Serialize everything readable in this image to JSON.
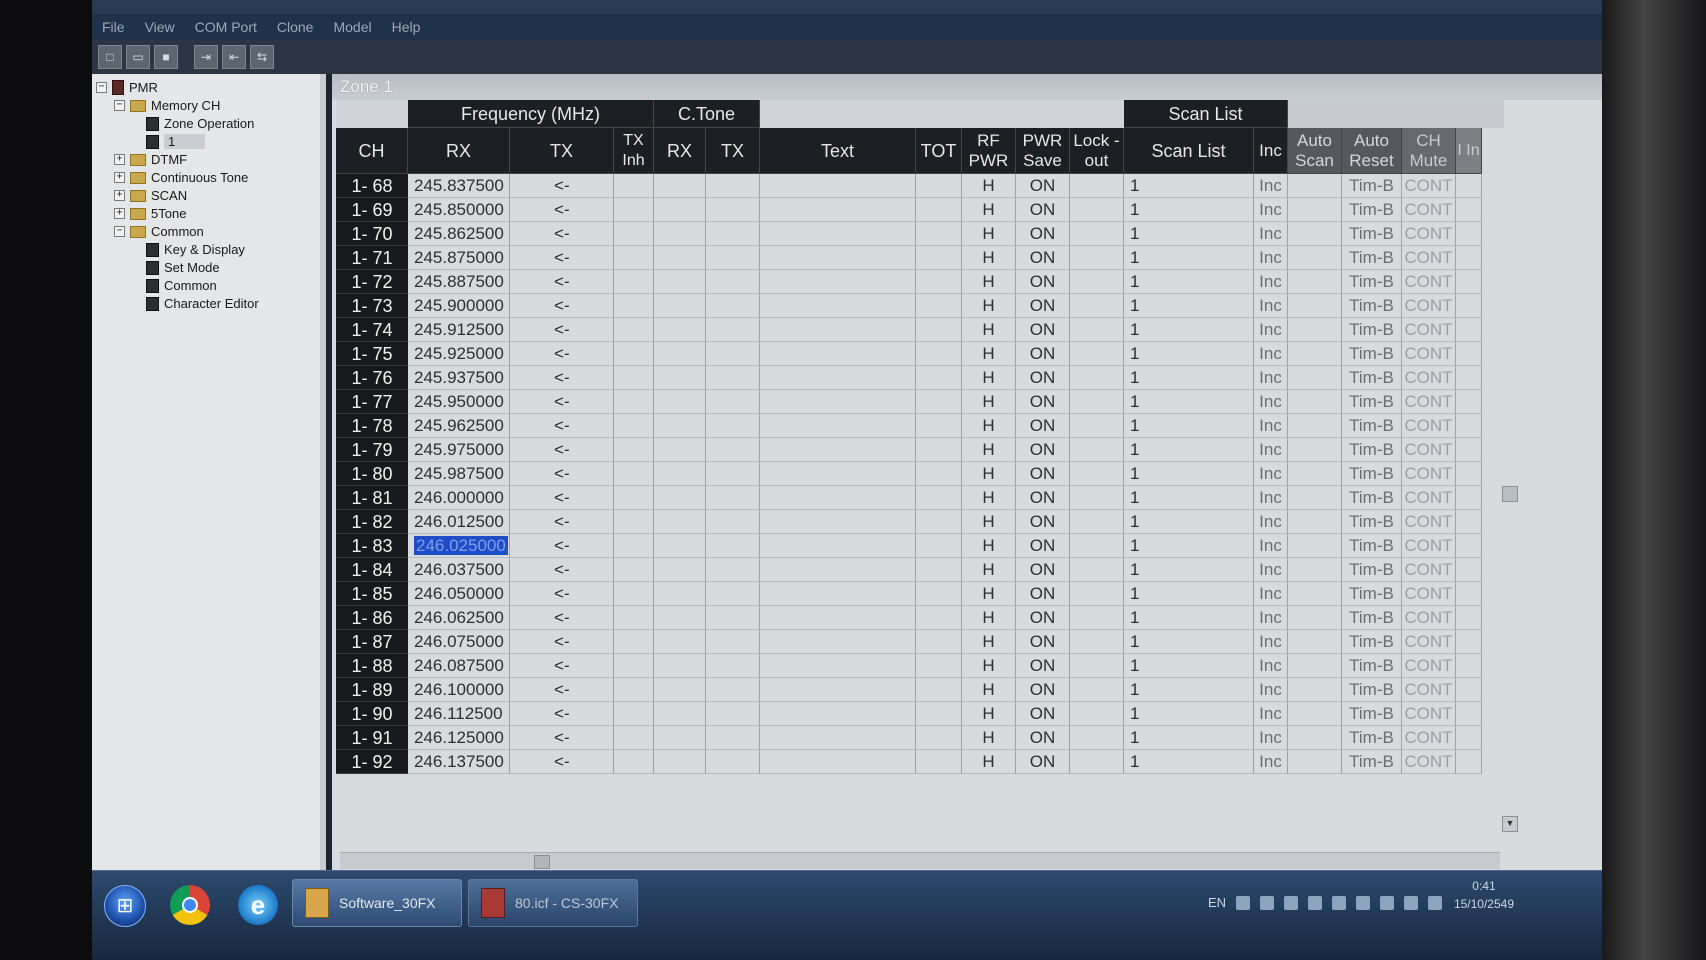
{
  "menu": [
    "File",
    "View",
    "COM Port",
    "Clone",
    "Model",
    "Help"
  ],
  "toolbar_icons": [
    "new-icon",
    "open-icon",
    "save-icon",
    "read-icon",
    "write-icon",
    "clone-icon"
  ],
  "tree": {
    "root": "PMR",
    "memory_ch": "Memory CH",
    "zone_operation": "Zone Operation",
    "zone_1": "1",
    "dtmf": "DTMF",
    "continuous_tone": "Continuous Tone",
    "scan": "SCAN",
    "five_tone": "5Tone",
    "common": "Common",
    "key_display": "Key & Display",
    "set_mode": "Set Mode",
    "common_sub": "Common",
    "character_editor": "Character Editor"
  },
  "zone_title": "Zone 1",
  "headers": {
    "frequency_group": "Frequency (MHz)",
    "ctone_group": "C.Tone",
    "scanlist_group": "Scan List",
    "ch": "CH",
    "rx": "RX",
    "tx": "TX",
    "tx_inh": "TX Inh",
    "ctone_rx": "RX",
    "ctone_tx": "TX",
    "text": "Text",
    "tot": "TOT",
    "rf_pwr": "RF PWR",
    "pwr_save": "PWR Save",
    "lockout": "Lock -out",
    "scan_list": "Scan List",
    "inc": "Inc",
    "auto_scan": "Auto Scan",
    "auto_reset": "Auto Reset",
    "ch_mute": "CH Mute",
    "last_col": "I In"
  },
  "rows": [
    {
      "ch": "1- 68",
      "rx": "245.837500",
      "tx": "<-",
      "rf_pwr": "H",
      "pwr_save": "ON",
      "scan_list": "1",
      "inc": "Inc",
      "auto_reset": "Tim-B",
      "ch_mute": "CONT"
    },
    {
      "ch": "1- 69",
      "rx": "245.850000",
      "tx": "<-",
      "rf_pwr": "H",
      "pwr_save": "ON",
      "scan_list": "1",
      "inc": "Inc",
      "auto_reset": "Tim-B",
      "ch_mute": "CONT"
    },
    {
      "ch": "1- 70",
      "rx": "245.862500",
      "tx": "<-",
      "rf_pwr": "H",
      "pwr_save": "ON",
      "scan_list": "1",
      "inc": "Inc",
      "auto_reset": "Tim-B",
      "ch_mute": "CONT"
    },
    {
      "ch": "1- 71",
      "rx": "245.875000",
      "tx": "<-",
      "rf_pwr": "H",
      "pwr_save": "ON",
      "scan_list": "1",
      "inc": "Inc",
      "auto_reset": "Tim-B",
      "ch_mute": "CONT"
    },
    {
      "ch": "1- 72",
      "rx": "245.887500",
      "tx": "<-",
      "rf_pwr": "H",
      "pwr_save": "ON",
      "scan_list": "1",
      "inc": "Inc",
      "auto_reset": "Tim-B",
      "ch_mute": "CONT"
    },
    {
      "ch": "1- 73",
      "rx": "245.900000",
      "tx": "<-",
      "rf_pwr": "H",
      "pwr_save": "ON",
      "scan_list": "1",
      "inc": "Inc",
      "auto_reset": "Tim-B",
      "ch_mute": "CONT"
    },
    {
      "ch": "1- 74",
      "rx": "245.912500",
      "tx": "<-",
      "rf_pwr": "H",
      "pwr_save": "ON",
      "scan_list": "1",
      "inc": "Inc",
      "auto_reset": "Tim-B",
      "ch_mute": "CONT"
    },
    {
      "ch": "1- 75",
      "rx": "245.925000",
      "tx": "<-",
      "rf_pwr": "H",
      "pwr_save": "ON",
      "scan_list": "1",
      "inc": "Inc",
      "auto_reset": "Tim-B",
      "ch_mute": "CONT"
    },
    {
      "ch": "1- 76",
      "rx": "245.937500",
      "tx": "<-",
      "rf_pwr": "H",
      "pwr_save": "ON",
      "scan_list": "1",
      "inc": "Inc",
      "auto_reset": "Tim-B",
      "ch_mute": "CONT"
    },
    {
      "ch": "1- 77",
      "rx": "245.950000",
      "tx": "<-",
      "rf_pwr": "H",
      "pwr_save": "ON",
      "scan_list": "1",
      "inc": "Inc",
      "auto_reset": "Tim-B",
      "ch_mute": "CONT"
    },
    {
      "ch": "1- 78",
      "rx": "245.962500",
      "tx": "<-",
      "rf_pwr": "H",
      "pwr_save": "ON",
      "scan_list": "1",
      "inc": "Inc",
      "auto_reset": "Tim-B",
      "ch_mute": "CONT"
    },
    {
      "ch": "1- 79",
      "rx": "245.975000",
      "tx": "<-",
      "rf_pwr": "H",
      "pwr_save": "ON",
      "scan_list": "1",
      "inc": "Inc",
      "auto_reset": "Tim-B",
      "ch_mute": "CONT"
    },
    {
      "ch": "1- 80",
      "rx": "245.987500",
      "tx": "<-",
      "rf_pwr": "H",
      "pwr_save": "ON",
      "scan_list": "1",
      "inc": "Inc",
      "auto_reset": "Tim-B",
      "ch_mute": "CONT"
    },
    {
      "ch": "1- 81",
      "rx": "246.000000",
      "tx": "<-",
      "rf_pwr": "H",
      "pwr_save": "ON",
      "scan_list": "1",
      "inc": "Inc",
      "auto_reset": "Tim-B",
      "ch_mute": "CONT"
    },
    {
      "ch": "1- 82",
      "rx": "246.012500",
      "tx": "<-",
      "rf_pwr": "H",
      "pwr_save": "ON",
      "scan_list": "1",
      "inc": "Inc",
      "auto_reset": "Tim-B",
      "ch_mute": "CONT"
    },
    {
      "ch": "1- 83",
      "rx": "246.025000",
      "tx": "<-",
      "rf_pwr": "H",
      "pwr_save": "ON",
      "scan_list": "1",
      "inc": "Inc",
      "auto_reset": "Tim-B",
      "ch_mute": "CONT",
      "selected": true
    },
    {
      "ch": "1- 84",
      "rx": "246.037500",
      "tx": "<-",
      "rf_pwr": "H",
      "pwr_save": "ON",
      "scan_list": "1",
      "inc": "Inc",
      "auto_reset": "Tim-B",
      "ch_mute": "CONT"
    },
    {
      "ch": "1- 85",
      "rx": "246.050000",
      "tx": "<-",
      "rf_pwr": "H",
      "pwr_save": "ON",
      "scan_list": "1",
      "inc": "Inc",
      "auto_reset": "Tim-B",
      "ch_mute": "CONT"
    },
    {
      "ch": "1- 86",
      "rx": "246.062500",
      "tx": "<-",
      "rf_pwr": "H",
      "pwr_save": "ON",
      "scan_list": "1",
      "inc": "Inc",
      "auto_reset": "Tim-B",
      "ch_mute": "CONT"
    },
    {
      "ch": "1- 87",
      "rx": "246.075000",
      "tx": "<-",
      "rf_pwr": "H",
      "pwr_save": "ON",
      "scan_list": "1",
      "inc": "Inc",
      "auto_reset": "Tim-B",
      "ch_mute": "CONT"
    },
    {
      "ch": "1- 88",
      "rx": "246.087500",
      "tx": "<-",
      "rf_pwr": "H",
      "pwr_save": "ON",
      "scan_list": "1",
      "inc": "Inc",
      "auto_reset": "Tim-B",
      "ch_mute": "CONT"
    },
    {
      "ch": "1- 89",
      "rx": "246.100000",
      "tx": "<-",
      "rf_pwr": "H",
      "pwr_save": "ON",
      "scan_list": "1",
      "inc": "Inc",
      "auto_reset": "Tim-B",
      "ch_mute": "CONT"
    },
    {
      "ch": "1- 90",
      "rx": "246.112500",
      "tx": "<-",
      "rf_pwr": "H",
      "pwr_save": "ON",
      "scan_list": "1",
      "inc": "Inc",
      "auto_reset": "Tim-B",
      "ch_mute": "CONT"
    },
    {
      "ch": "1- 91",
      "rx": "246.125000",
      "tx": "<-",
      "rf_pwr": "H",
      "pwr_save": "ON",
      "scan_list": "1",
      "inc": "Inc",
      "auto_reset": "Tim-B",
      "ch_mute": "CONT"
    },
    {
      "ch": "1- 92",
      "rx": "246.137500",
      "tx": "<-",
      "rf_pwr": "H",
      "pwr_save": "ON",
      "scan_list": "1",
      "inc": "Inc",
      "auto_reset": "Tim-B",
      "ch_mute": "CONT"
    }
  ],
  "taskbar": {
    "task_software": "Software_30FX",
    "task_file": "80.icf - CS-30FX",
    "lang": "EN",
    "time": "0:41",
    "date": "15/10/2549"
  },
  "colors": {
    "header_bg": "#1c1f24",
    "selection": "#1f4cc7",
    "grid_bg": "#d7dbde"
  }
}
